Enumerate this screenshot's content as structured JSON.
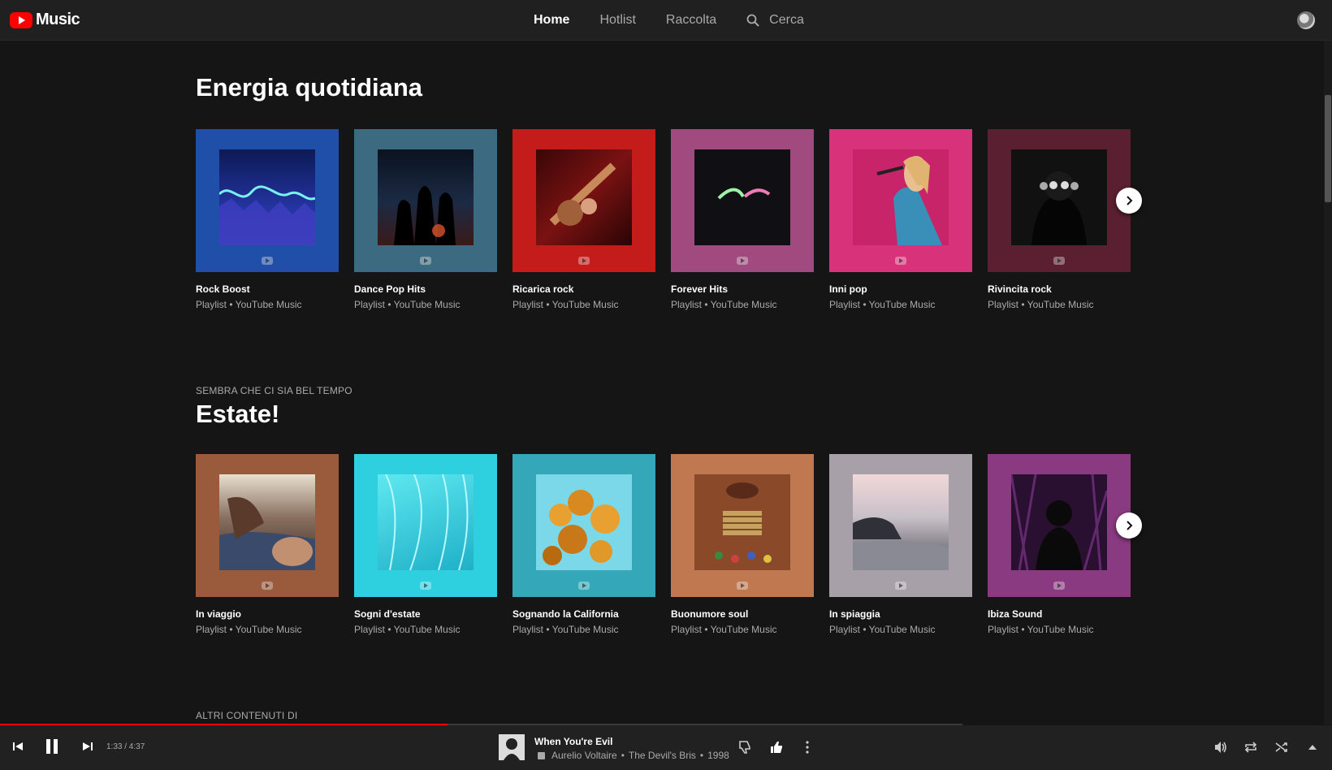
{
  "app": {
    "logo_text": "Music"
  },
  "nav": {
    "items": [
      "Home",
      "Hotlist",
      "Raccolta"
    ],
    "search_label": "Cerca"
  },
  "sections": [
    {
      "eyebrow": "",
      "title": "Energia quotidiana",
      "cards": [
        {
          "title": "Rock Boost",
          "subtitle": "Playlist • YouTube Music"
        },
        {
          "title": "Dance Pop Hits",
          "subtitle": "Playlist • YouTube Music"
        },
        {
          "title": "Ricarica rock",
          "subtitle": "Playlist • YouTube Music"
        },
        {
          "title": "Forever Hits",
          "subtitle": "Playlist • YouTube Music"
        },
        {
          "title": "Inni pop",
          "subtitle": "Playlist • YouTube Music"
        },
        {
          "title": "Rivincita rock",
          "subtitle": "Playlist • YouTube Music"
        }
      ]
    },
    {
      "eyebrow": "SEMBRA CHE CI SIA BEL TEMPO",
      "title": "Estate!",
      "cards": [
        {
          "title": "In viaggio",
          "subtitle": "Playlist • YouTube Music"
        },
        {
          "title": "Sogni d'estate",
          "subtitle": "Playlist • YouTube Music"
        },
        {
          "title": "Sognando la California",
          "subtitle": "Playlist • YouTube Music"
        },
        {
          "title": "Buonumore soul",
          "subtitle": "Playlist • YouTube Music"
        },
        {
          "title": "In spiaggia",
          "subtitle": "Playlist • YouTube Music"
        },
        {
          "title": "Ibiza Sound",
          "subtitle": "Playlist • YouTube Music"
        }
      ]
    },
    {
      "eyebrow": "ALTRI CONTENUTI DI"
    }
  ],
  "player": {
    "time": "1:33 / 4:37",
    "progress": 0.336,
    "track_title": "When You're Evil",
    "artist": "Aurelio Voltaire",
    "album": "The Devil's Bris",
    "year": "1998",
    "separator": "•"
  },
  "colors": {
    "accent": "#ff0000",
    "background": "#151515",
    "bar": "#212121"
  }
}
